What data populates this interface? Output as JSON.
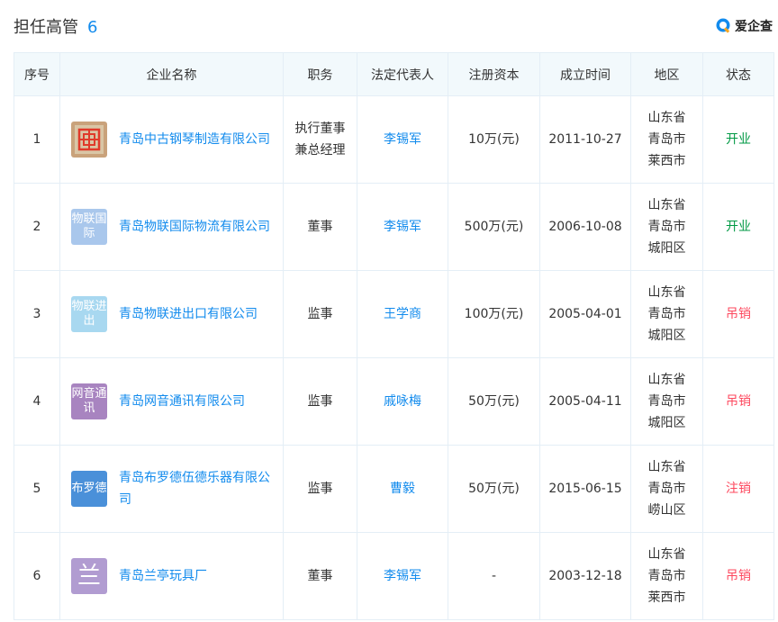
{
  "header": {
    "title": "担任高管",
    "count": "6",
    "brand_text": "爱企查",
    "brand_icon": "search-q-icon",
    "brand_color": "#128bed"
  },
  "columns": [
    "序号",
    "企业名称",
    "职务",
    "法定代表人",
    "注册资本",
    "成立时间",
    "地区",
    "状态"
  ],
  "rows": [
    {
      "index": "1",
      "logo_text": "",
      "logo_icon": "company-seal-icon",
      "company": "青岛中古钢琴制造有限公司",
      "position": "执行董事兼总经理",
      "legal_rep": "李锡军",
      "capital": "10万(元)",
      "founded": "2011-10-27",
      "region": "山东省青岛市莱西市",
      "status": "开业"
    },
    {
      "index": "2",
      "logo_text": "物联国际",
      "company": "青岛物联国际物流有限公司",
      "position": "董事",
      "legal_rep": "李锡军",
      "capital": "500万(元)",
      "founded": "2006-10-08",
      "region": "山东省青岛市城阳区",
      "status": "开业"
    },
    {
      "index": "3",
      "logo_text": "物联进出",
      "company": "青岛物联进出口有限公司",
      "position": "监事",
      "legal_rep": "王学商",
      "capital": "100万(元)",
      "founded": "2005-04-01",
      "region": "山东省青岛市城阳区",
      "status": "吊销"
    },
    {
      "index": "4",
      "logo_text": "网音通讯",
      "company": "青岛网音通讯有限公司",
      "position": "监事",
      "legal_rep": "戚咏梅",
      "capital": "50万(元)",
      "founded": "2005-04-11",
      "region": "山东省青岛市城阳区",
      "status": "吊销"
    },
    {
      "index": "5",
      "logo_text": "布罗德",
      "company": "青岛布罗德伍德乐器有限公司",
      "position": "监事",
      "legal_rep": "曹毅",
      "capital": "50万(元)",
      "founded": "2015-06-15",
      "region": "山东省青岛市崂山区",
      "status": "注销"
    },
    {
      "index": "6",
      "logo_text": "兰",
      "company": "青岛兰亭玩具厂",
      "position": "董事",
      "legal_rep": "李锡军",
      "capital": "-",
      "founded": "2003-12-18",
      "region": "山东省青岛市莱西市",
      "status": "吊销"
    }
  ],
  "colors": {
    "link": "#128bed",
    "status_open": "#009944",
    "status_closed": "#fd485e",
    "header_bg": "#f2f9fc",
    "border": "#e4eef6"
  }
}
